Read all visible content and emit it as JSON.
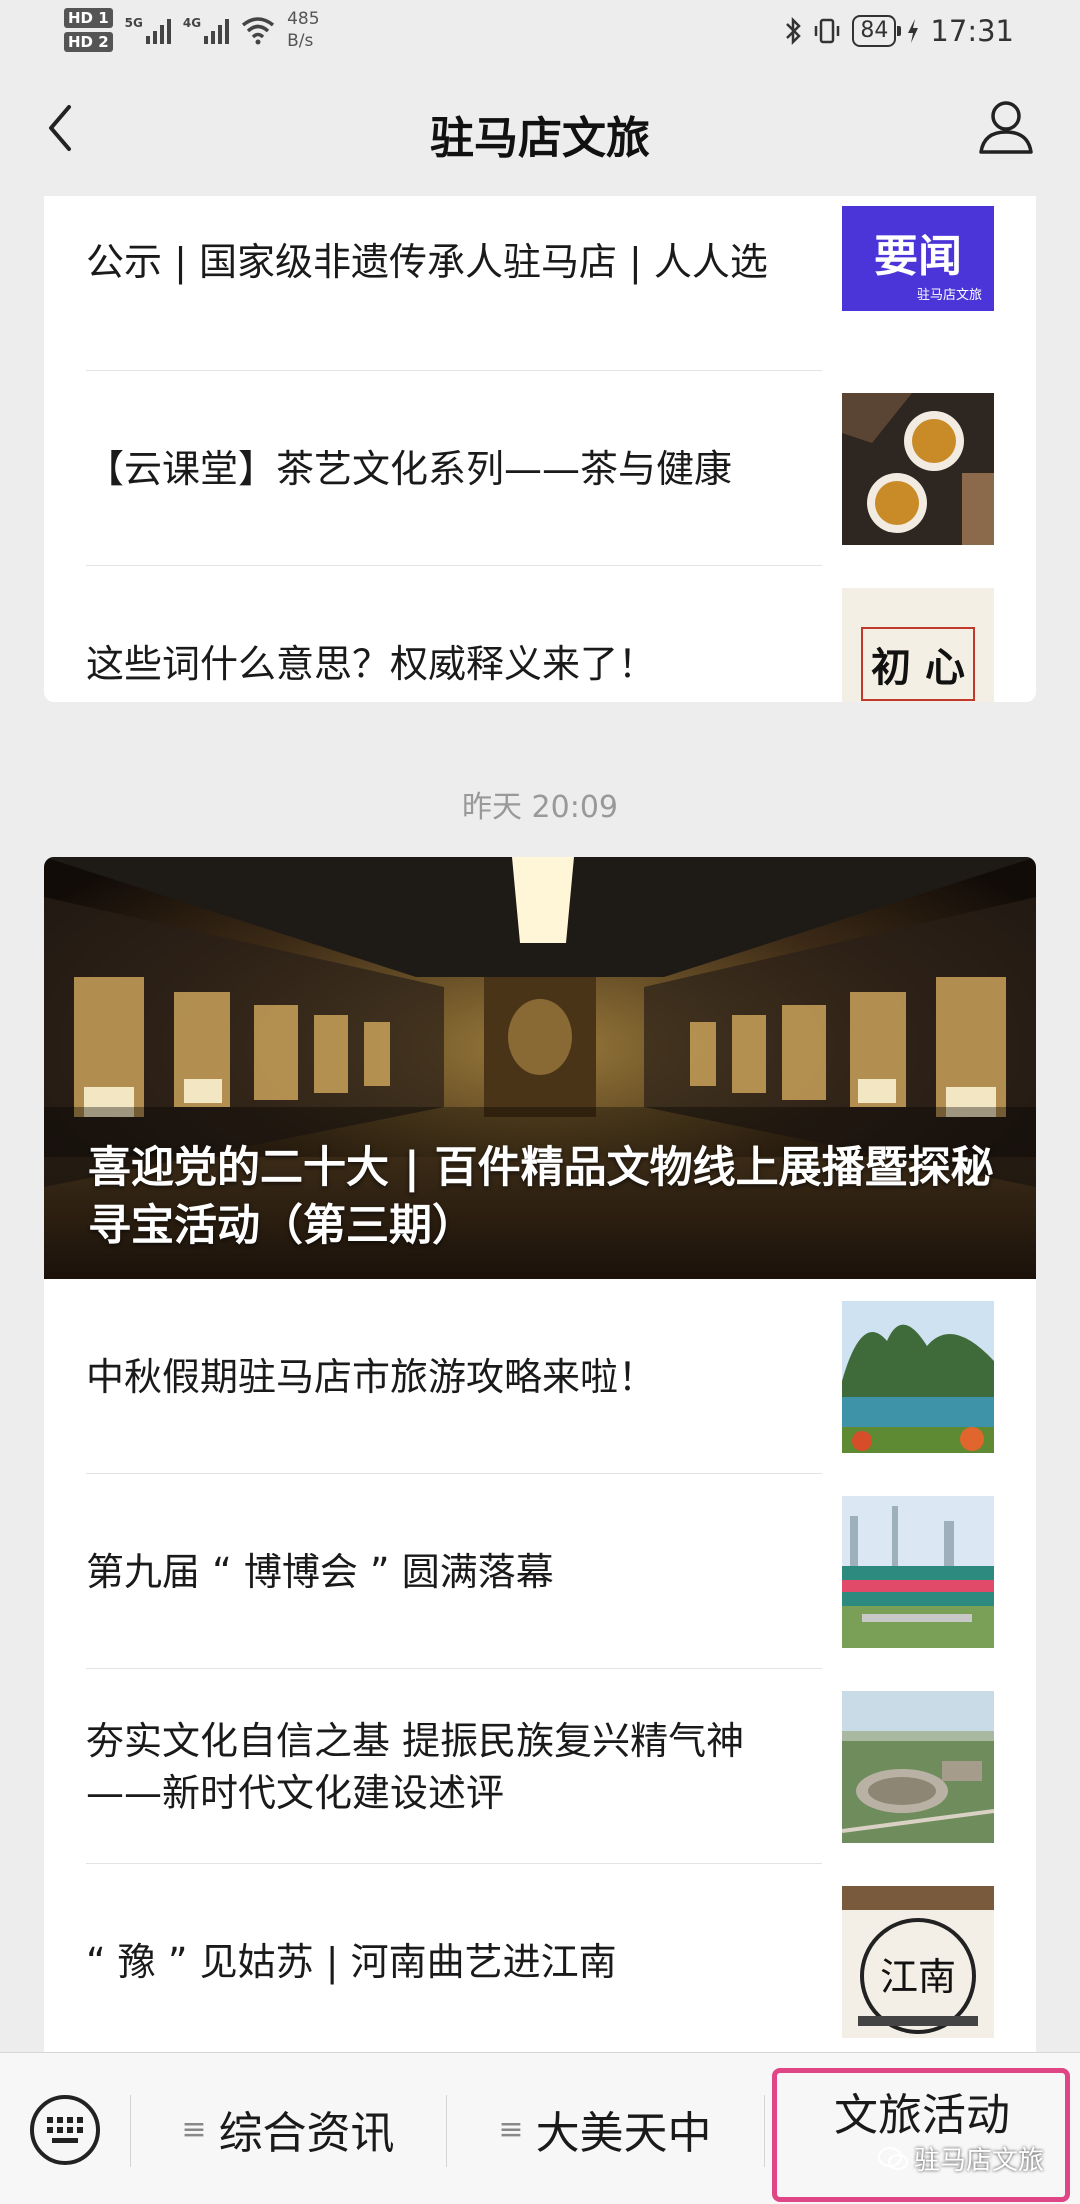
{
  "status_bar": {
    "hd1": "HD 1",
    "hd2": "HD 2",
    "net1": "5G",
    "net2": "4G",
    "speed_value": "485",
    "speed_unit": "B/s",
    "battery": "84",
    "time": "17:31"
  },
  "header": {
    "title": "驻马店文旅",
    "back_icon": "chevron-left-icon",
    "profile_icon": "user-icon"
  },
  "card1": {
    "items": [
      {
        "title": "公示 | 国家级非遗传承人驻马店 | 人人选",
        "thumb_text": "要闻",
        "thumb_sub": "驻马店文旅"
      },
      {
        "title": "【云课堂】茶艺文化系列——茶与健康"
      },
      {
        "title": "这些词什么意思？权威释义来了！",
        "thumb_text": "初 心"
      }
    ]
  },
  "timestamp": "昨天 20:09",
  "card2": {
    "hero_title": "喜迎党的二十大 | 百件精品文物线上展播暨探秘寻宝活动（第三期）",
    "items": [
      {
        "title": "中秋假期驻马店市旅游攻略来啦！"
      },
      {
        "title": "第九届 “ 博博会 ” 圆满落幕"
      },
      {
        "title": "夯实文化自信之基 提振民族复兴精气神——新时代文化建设述评"
      },
      {
        "title": "“ 豫 ” 见姑苏 | 河南曲艺进江南",
        "thumb_text": "江南"
      }
    ]
  },
  "bottom_menu": {
    "keyboard_icon": "keyboard-icon",
    "items": [
      {
        "label": "综合资讯"
      },
      {
        "label": "大美天中"
      },
      {
        "label": "文旅活动"
      }
    ],
    "watermark": "驻马店文旅",
    "highlight_color": "#e04585"
  }
}
